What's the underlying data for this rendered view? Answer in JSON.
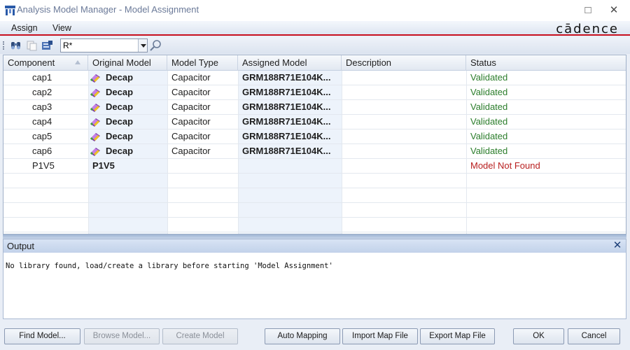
{
  "window": {
    "title": "Analysis Model Manager - Model Assignment",
    "minimize_glyph": "□",
    "close_glyph": "✕"
  },
  "menu": {
    "items": [
      "Assign",
      "View"
    ],
    "brand_logo": "cādence"
  },
  "toolbar": {
    "icons": [
      "binoculars-icon",
      "copy-icon",
      "library-icon"
    ],
    "filter_value": "R*",
    "find_icon": "magnifier-icon"
  },
  "grid": {
    "columns": [
      "Component",
      "Original Model",
      "Model Type",
      "Assigned Model",
      "Description",
      "Status"
    ],
    "rows": [
      {
        "component": "cap1",
        "original": "Decap",
        "type": "Capacitor",
        "assigned": "GRM188R71E104K...",
        "description": "",
        "status": "Validated",
        "status_kind": "ok",
        "icon": true
      },
      {
        "component": "cap2",
        "original": "Decap",
        "type": "Capacitor",
        "assigned": "GRM188R71E104K...",
        "description": "",
        "status": "Validated",
        "status_kind": "ok",
        "icon": true
      },
      {
        "component": "cap3",
        "original": "Decap",
        "type": "Capacitor",
        "assigned": "GRM188R71E104K...",
        "description": "",
        "status": "Validated",
        "status_kind": "ok",
        "icon": true
      },
      {
        "component": "cap4",
        "original": "Decap",
        "type": "Capacitor",
        "assigned": "GRM188R71E104K...",
        "description": "",
        "status": "Validated",
        "status_kind": "ok",
        "icon": true
      },
      {
        "component": "cap5",
        "original": "Decap",
        "type": "Capacitor",
        "assigned": "GRM188R71E104K...",
        "description": "",
        "status": "Validated",
        "status_kind": "ok",
        "icon": true
      },
      {
        "component": "cap6",
        "original": "Decap",
        "type": "Capacitor",
        "assigned": "GRM188R71E104K...",
        "description": "",
        "status": "Validated",
        "status_kind": "ok",
        "icon": true
      },
      {
        "component": "P1V5",
        "original": "P1V5",
        "type": "",
        "assigned": "",
        "description": "",
        "status": "Model Not Found",
        "status_kind": "bad",
        "icon": false
      }
    ]
  },
  "output": {
    "title": "Output",
    "close_glyph": "✕",
    "message": "No library found, load/create a library before starting 'Model Assignment'"
  },
  "buttons": {
    "find_model": "Find Model...",
    "browse_model": "Browse Model...",
    "create_model": "Create Model",
    "auto_mapping": "Auto Mapping",
    "import_map": "Import Map File",
    "export_map": "Export Map File",
    "ok": "OK",
    "cancel": "Cancel"
  },
  "colors": {
    "accent_red": "#c8101e",
    "status_ok": "#2b7d2b",
    "status_bad": "#b81e1e"
  }
}
